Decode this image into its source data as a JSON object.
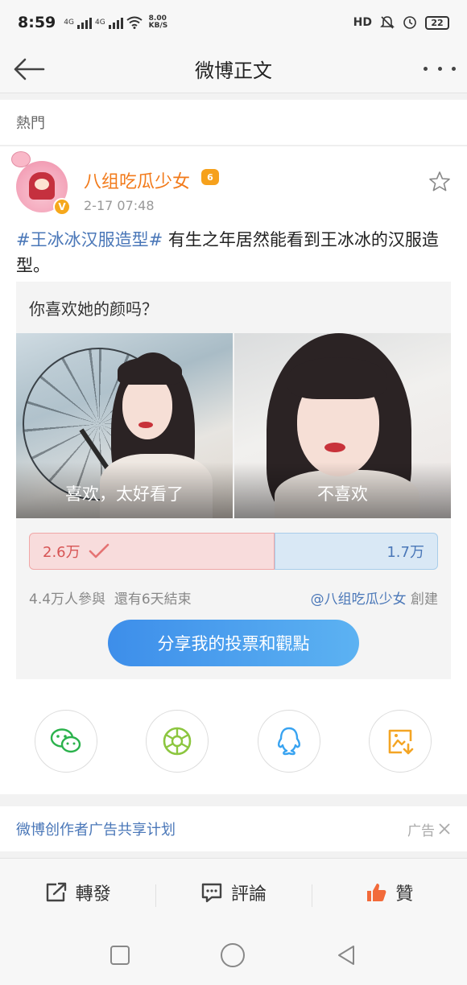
{
  "status_bar": {
    "time": "8:59",
    "net1": "4G",
    "net2": "4G",
    "speed_value": "8.00",
    "speed_unit": "KB/S",
    "hd": "HD",
    "battery": "22"
  },
  "header": {
    "title": "微博正文",
    "back_icon": "back-arrow-icon",
    "more_icon": "more-dots-icon"
  },
  "section": {
    "label": "熱門"
  },
  "post": {
    "author": "八组吃瓜少女",
    "time": "2-17 07:48",
    "topic": "#王冰冰汉服造型#",
    "text": " 有生之年居然能看到王冰冰的汉服造型。",
    "verified_badge": "V",
    "member_level": "6",
    "avatar_caption": "八组吃瓜少女"
  },
  "poll": {
    "question": "你喜欢她的颜吗？",
    "options": [
      {
        "label": "喜欢，太好看了",
        "count": "2.6万",
        "share": 0.6
      },
      {
        "label": "不喜欢",
        "count": "1.7万",
        "share": 0.4
      }
    ],
    "participants": "4.4万人參與",
    "remaining": "還有6天結束",
    "creator": "@八组吃瓜少女",
    "creator_suffix": " 創建",
    "share_button": "分享我的投票和觀點"
  },
  "share_targets": [
    "wechat-icon",
    "moments-icon",
    "qq-icon",
    "save-image-icon"
  ],
  "ad": {
    "text": "微博创作者广告共享计划",
    "tag": "广告"
  },
  "actions": {
    "repost": "轉發",
    "comment": "評論",
    "like": "贊"
  },
  "colors": {
    "accent_blue": "#4a77b8",
    "author_orange": "#f27a1a",
    "like_orange": "#f26a3a"
  }
}
